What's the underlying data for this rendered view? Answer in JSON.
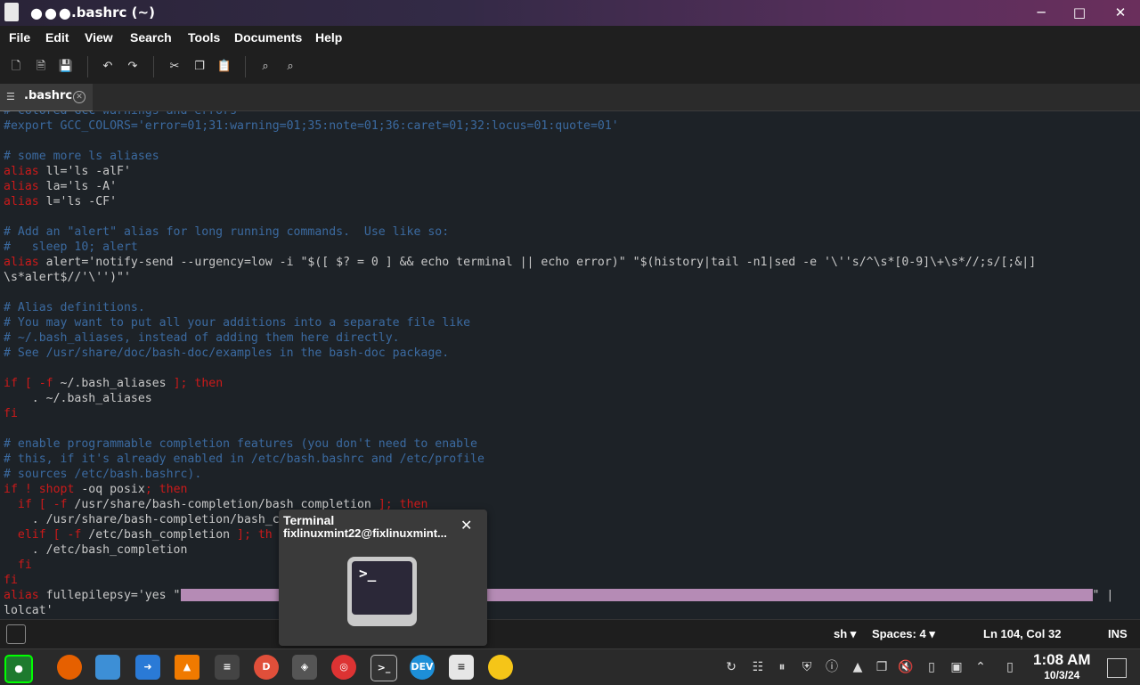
{
  "window": {
    "dots": "●●●",
    "title": ".bashrc (~)",
    "minimize": "─",
    "maximize": "□",
    "close": "✕"
  },
  "menu": [
    "File",
    "Edit",
    "View",
    "Search",
    "Tools",
    "Documents",
    "Help"
  ],
  "toolbar_icons": [
    "new-document-icon",
    "open-document-icon",
    "save-icon",
    "undo-icon",
    "redo-icon",
    "cut-icon",
    "copy-icon",
    "paste-icon",
    "search-icon",
    "replace-icon"
  ],
  "tab": {
    "label": ".bashrc",
    "close": "✕"
  },
  "code": {
    "l1": "# colored GCC warnings and errors",
    "l2": "#export GCC_COLORS='error=01;31:warning=01;35:note=01;36:caret=01;32:locus=01:quote=01'",
    "l4": "# some more ls aliases",
    "l5a": "alias",
    "l5b": " ll='ls -alF'",
    "l6a": "alias",
    "l6b": " la='ls -A'",
    "l7a": "alias",
    "l7b": " l='ls -CF'",
    "l9": "# Add an \"alert\" alias for long running commands.  Use like so:",
    "l10": "#   sleep 10; alert",
    "l11a": "alias",
    "l11b": " alert='notify-send --urgency=low -i \"$([ $? = 0 ] && echo terminal || echo error)\" \"$(history|tail -n1|sed -e '\\''s/^\\s*[0-9]\\+\\s*//;s/[;&|]",
    "l12": "\\s*alert$//'\\'')\"'",
    "l14": "# Alias definitions.",
    "l15": "# You may want to put all your additions into a separate file like",
    "l16": "# ~/.bash_aliases, instead of adding them here directly.",
    "l17": "# See /usr/share/doc/bash-doc/examples in the bash-doc package.",
    "l19a": "if [ -f",
    "l19b": " ~/.bash_aliases",
    "l19c": " ]; then",
    "l20": "    . ~/.bash_aliases",
    "l21": "fi",
    "l23": "# enable programmable completion features (you don't need to enable",
    "l24": "# this, if it's already enabled in /etc/bash.bashrc and /etc/profile",
    "l25": "# sources /etc/bash.bashrc).",
    "l26a": "if ! shopt",
    "l26b": " -oq posix",
    "l26c": "; then",
    "l27a": "  if [ -f",
    "l27b": " /usr/share/bash-completion/bash_completion",
    "l27c": " ]; then",
    "l28": "    . /usr/share/bash-completion/bash_c",
    "l29a": "  elif [ -f",
    "l29b": " /etc/bash_completion",
    "l29c": " ]; th",
    "l30": "    . /etc/bash_completion",
    "l31": "  fi",
    "l32": "fi",
    "l33a": "alias",
    "l33b": " fullepilepsy='yes \"",
    "l33c": "\" |",
    "l34": "lolcat'"
  },
  "status": {
    "lang": "sh ▾",
    "spaces": "Spaces: 4 ▾",
    "pos": "Ln 104, Col 32",
    "mode": "INS"
  },
  "notification": {
    "title": "Terminal",
    "body": "fixlinuxmint22@fixlinuxmint...",
    "close": "✕",
    "icon_prompt": ">_"
  },
  "taskbar_apps": [
    "menu-icon",
    "firefox-icon",
    "files-icon",
    "software-manager-icon",
    "vlc-icon",
    "mixer-icon",
    "chrome-icon",
    "vscode-icon",
    "lifesaver-icon",
    "terminal-icon",
    "edge-dev-icon",
    "text-editor-icon",
    "pacman-icon"
  ],
  "clock": {
    "time": "1:08 AM",
    "date": "10/3/24"
  }
}
